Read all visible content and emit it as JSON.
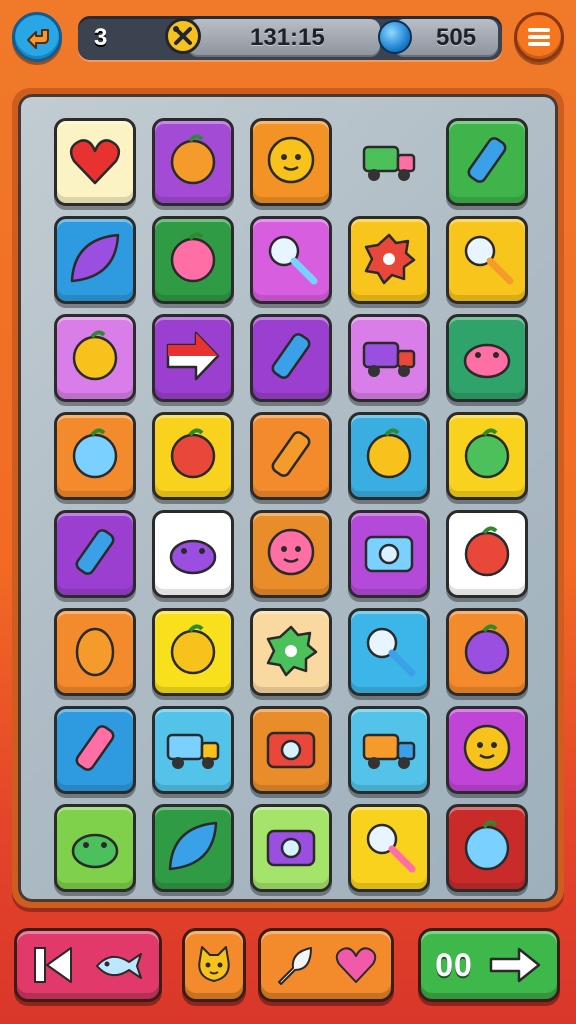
{
  "hud": {
    "level": "3",
    "time": "131:15",
    "coins": "505",
    "back_icon": "back-arrow-icon",
    "menu_icon": "hamburger-menu-icon",
    "tool_icon": "tools-icon",
    "coin_icon": "blue-gem-icon"
  },
  "board": {
    "rows": 8,
    "cols": 5,
    "tiles": [
      {
        "icon": "heart-icon",
        "color": "#fbf3c3"
      },
      {
        "icon": "orange-fruit-icon",
        "color": "#a44bd6"
      },
      {
        "icon": "girl-face-icon",
        "color": "#f39325"
      },
      {
        "icon": "red-truck-icon",
        "color": ""
      },
      {
        "icon": "yellow-crayon-icon",
        "color": "#3eb44a"
      },
      {
        "icon": "green-leaf-icon",
        "color": "#2e9be0"
      },
      {
        "icon": "cherry-icon",
        "color": "#2f9b45"
      },
      {
        "icon": "magnifier-purple-icon",
        "color": "#d85ee0"
      },
      {
        "icon": "green-blob-icon",
        "color": "#f8c51c"
      },
      {
        "icon": "purple-rattle-icon",
        "color": "#f8c51c"
      },
      {
        "icon": "coconut-icon",
        "color": "#d97ee8"
      },
      {
        "icon": "red-arrow-flag-icon",
        "color": "#9b3fd0"
      },
      {
        "icon": "water-bottle-icon",
        "color": "#9b3fd0"
      },
      {
        "icon": "camper-van-icon",
        "color": "#d97ee8"
      },
      {
        "icon": "green-creature-icon",
        "color": "#2fa36a"
      },
      {
        "icon": "red-pacifier-icon",
        "color": "#f38a2b"
      },
      {
        "icon": "taco-icon",
        "color": "#f8d21c"
      },
      {
        "icon": "blue-bottle-icon",
        "color": "#f38a2b"
      },
      {
        "icon": "yellow-brush-icon",
        "color": "#3aaee0"
      },
      {
        "icon": "orange-ball-icon",
        "color": "#f8d21c"
      },
      {
        "icon": "blue-crayon-icon",
        "color": "#9b3fd0"
      },
      {
        "icon": "green-frog-icon",
        "color": "#ffffff"
      },
      {
        "icon": "green-smiley-icon",
        "color": "#e98c2a"
      },
      {
        "icon": "radio-icon",
        "color": "#b44ad9"
      },
      {
        "icon": "tomato-icon",
        "color": "#ffffff"
      },
      {
        "icon": "egg-icon",
        "color": "#f38a2b"
      },
      {
        "icon": "blue-eye-icon",
        "color": "#f8e01c"
      },
      {
        "icon": "purple-gear-icon",
        "color": "#f9d9a0"
      },
      {
        "icon": "magnifying-glass-icon",
        "color": "#3cb6e8"
      },
      {
        "icon": "red-apple-icon",
        "color": "#f38a2b"
      },
      {
        "icon": "green-tube-icon",
        "color": "#2e9be0"
      },
      {
        "icon": "purple-truck-icon",
        "color": "#53c3ea"
      },
      {
        "icon": "pink-photo-icon",
        "color": "#e98c2a"
      },
      {
        "icon": "yellow-truck-icon",
        "color": "#53c3ea"
      },
      {
        "icon": "sun-face-icon",
        "color": "#c045d6"
      },
      {
        "icon": "puppy-icon",
        "color": "#7fd14b"
      },
      {
        "icon": "banana-icon",
        "color": "#2f9b45"
      },
      {
        "icon": "pink-camera-icon",
        "color": "#a5e46a"
      },
      {
        "icon": "purple-key-icon",
        "color": "#f8d21c"
      },
      {
        "icon": "purple-ball-icon",
        "color": "#c92b2b"
      }
    ]
  },
  "footer": {
    "rewind_icon": "rewind-icon",
    "fish_icon": "fish-icon",
    "hint_icon": "cat-face-icon",
    "feather_icon": "feather-icon",
    "heart_icon": "pink-heart-icon",
    "next_label": "00",
    "next_icon": "right-arrow-icon"
  }
}
